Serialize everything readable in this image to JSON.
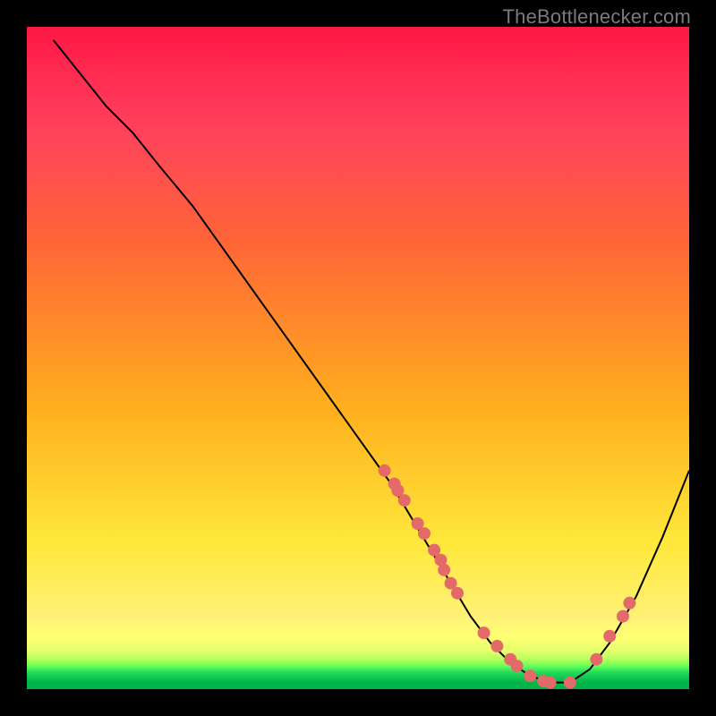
{
  "attribution": "TheBottlenecker.com",
  "chart_data": {
    "type": "line",
    "title": "",
    "xlabel": "",
    "ylabel": "",
    "xlim": [
      0,
      100
    ],
    "ylim": [
      0,
      100
    ],
    "series": [
      {
        "name": "bottleneck-curve",
        "x": [
          4,
          8,
          12,
          16,
          20,
          25,
          30,
          35,
          40,
          45,
          50,
          55,
          58,
          61,
          64,
          67,
          70,
          73,
          76,
          79,
          82,
          85,
          88,
          92,
          96,
          100
        ],
        "y": [
          98,
          93,
          88,
          84,
          79,
          73,
          66,
          59,
          52,
          45,
          38,
          31,
          26,
          21,
          16,
          11,
          7,
          4,
          2,
          1,
          1,
          3,
          7,
          14,
          23,
          33
        ]
      }
    ],
    "markers": {
      "name": "sample-dots",
      "x": [
        54,
        55.5,
        56,
        57,
        59,
        60,
        61.5,
        62.5,
        63,
        64,
        65,
        69,
        71,
        73,
        74,
        76,
        78,
        79,
        82,
        86,
        88,
        90,
        91
      ],
      "y": [
        33,
        31,
        30,
        28.5,
        25,
        23.5,
        21,
        19.5,
        18,
        16,
        14.5,
        8.5,
        6.5,
        4.5,
        3.5,
        2,
        1.2,
        1,
        1,
        4.5,
        8,
        11,
        13
      ]
    },
    "background_gradient": {
      "top": "#ff1744",
      "mid": "#ffe83b",
      "bottom": "#00b44a"
    }
  }
}
